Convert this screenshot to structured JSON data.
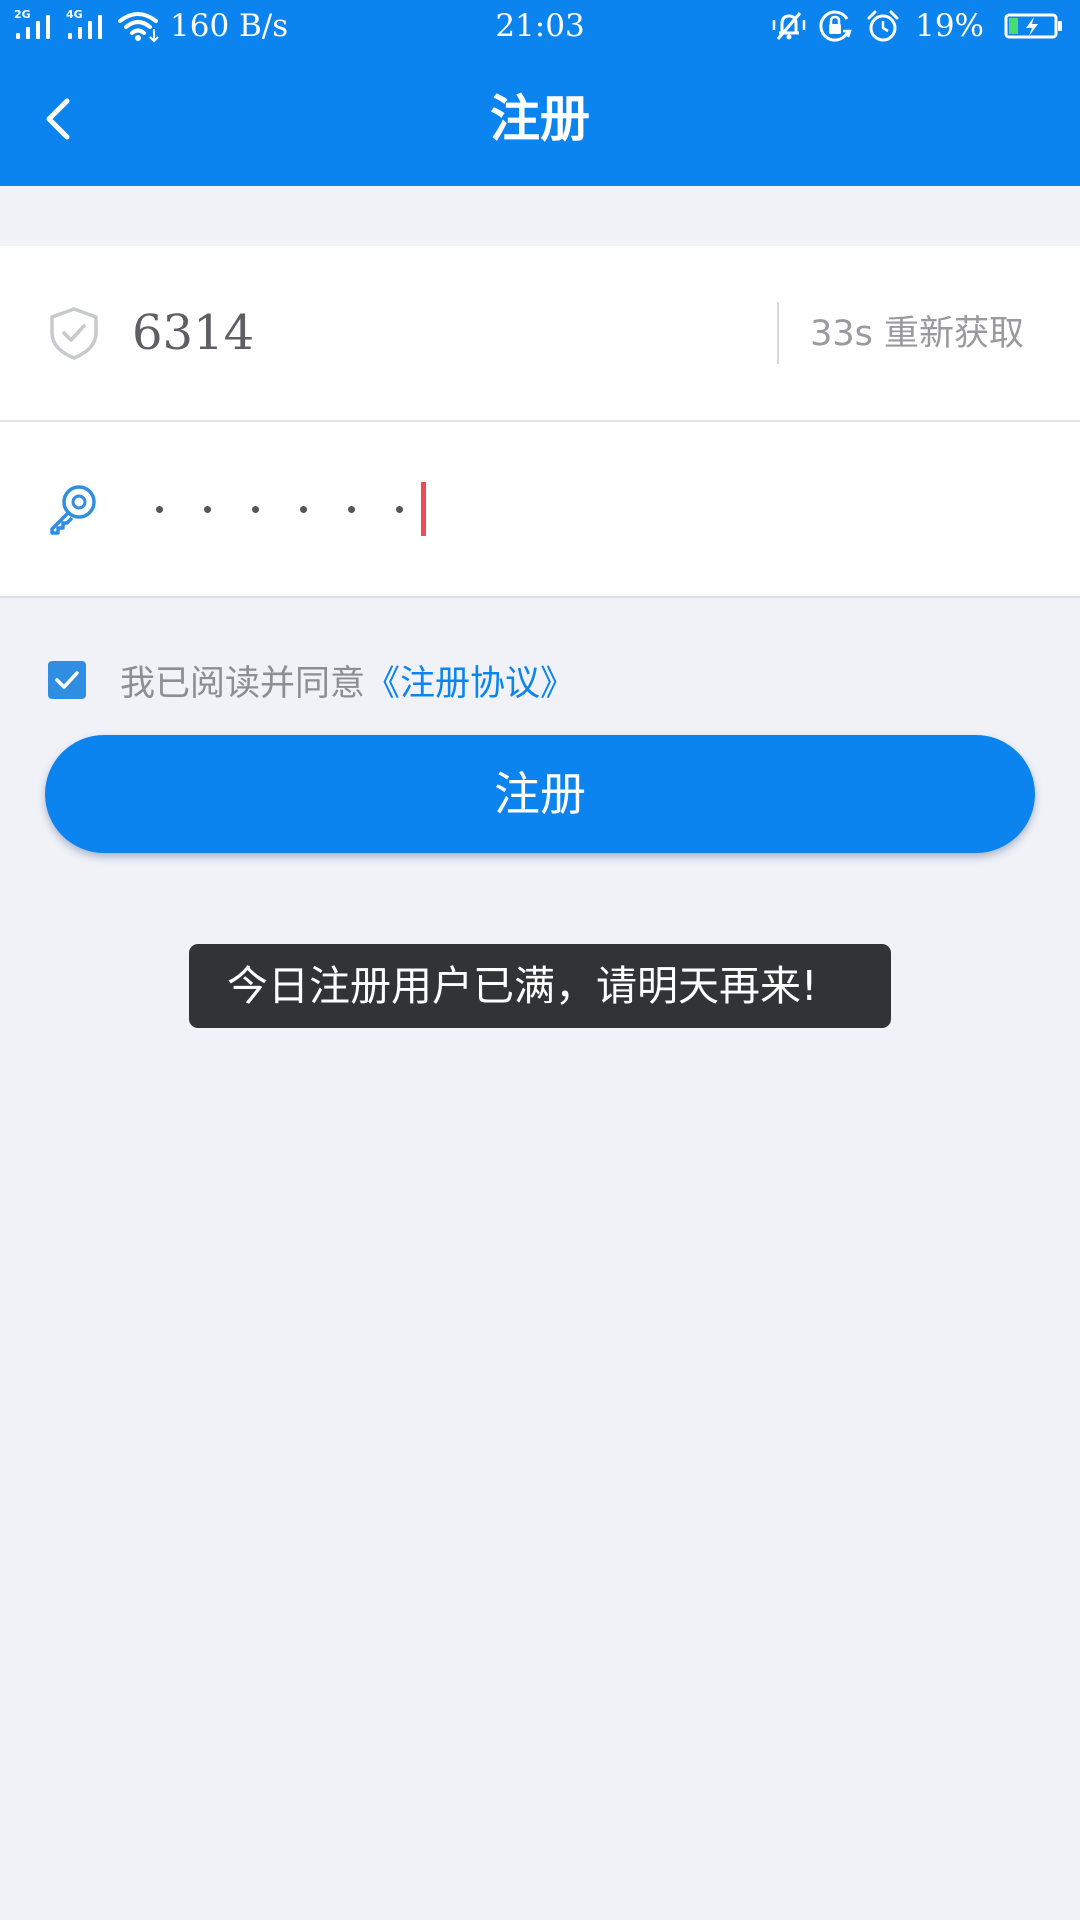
{
  "status_bar": {
    "sim1_label": "2G",
    "sim2_label": "4G",
    "net_speed": "160 B/s",
    "time": "21:03",
    "battery_percent": "19%",
    "icons": [
      "signal-2g-icon",
      "signal-4g-icon",
      "wifi-icon",
      "vibrate-icon",
      "rotation-lock-icon",
      "alarm-icon",
      "battery-charging-icon"
    ]
  },
  "header": {
    "title": "注册",
    "back_icon": "chevron-left-icon"
  },
  "form": {
    "code_value": "6314",
    "code_icon": "shield-check-icon",
    "resend_label": "33s 重新获取",
    "password_icon": "key-icon",
    "password_length": 6
  },
  "agreement": {
    "checked": true,
    "text": "我已阅读并同意",
    "link": "《注册协议》"
  },
  "register_button": {
    "label": "注册"
  },
  "toast": {
    "message": "今日注册用户已满，请明天再来!"
  },
  "colors": {
    "primary": "#0c84f0",
    "background": "#f0f2f8",
    "toast_bg": "#323335",
    "caret": "#f04b55"
  }
}
